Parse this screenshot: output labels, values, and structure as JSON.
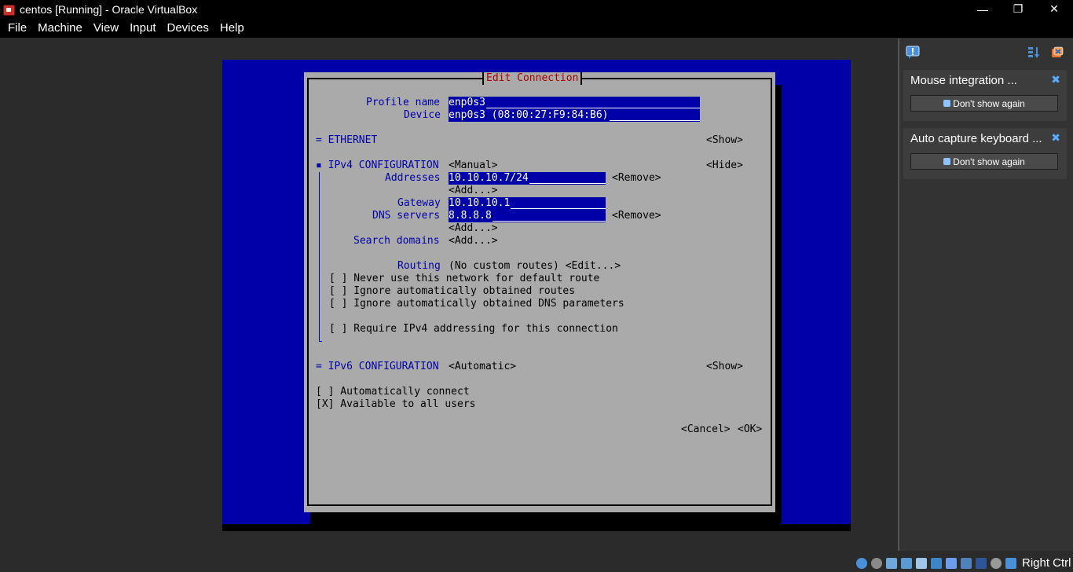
{
  "window": {
    "title": "centos [Running] - Oracle VirtualBox",
    "controls": {
      "minimize": "—",
      "restore": "❐",
      "close": "✕"
    }
  },
  "menu": [
    "File",
    "Machine",
    "View",
    "Input",
    "Devices",
    "Help"
  ],
  "nmtui": {
    "dialog_title": "Edit Connection",
    "profile_name_label": "Profile name",
    "profile_name_value": "enp0s3",
    "device_label": "Device",
    "device_value": "enp0s3 (08:00:27:F9:84:B6)",
    "ethernet_label": "= ETHERNET",
    "ethernet_toggle": "<Show>",
    "ipv4_label": "▪ IPv4 CONFIGURATION",
    "ipv4_mode": "<Manual>",
    "ipv4_toggle": "<Hide>",
    "addresses_label": "Addresses",
    "address_value": "10.10.10.7/24",
    "remove_label": "<Remove>",
    "add_label": "<Add...>",
    "gateway_label": "Gateway",
    "gateway_value": "10.10.10.1",
    "dns_label": "DNS servers",
    "dns_value": "8.8.8.8",
    "search_domains_label": "Search domains",
    "routing_label": "Routing",
    "routing_value": "(No custom routes) <Edit...>",
    "check_never_default": "[ ] Never use this network for default route",
    "check_ignore_routes": "[ ] Ignore automatically obtained routes",
    "check_ignore_dns": "[ ] Ignore automatically obtained DNS parameters",
    "check_require_ipv4": "[ ] Require IPv4 addressing for this connection",
    "ipv6_label": "= IPv6 CONFIGURATION",
    "ipv6_mode": "<Automatic>",
    "ipv6_toggle": "<Show>",
    "auto_connect": "[ ] Automatically connect",
    "all_users": "[X] Available to all users",
    "cancel": "<Cancel>",
    "ok": "<OK>"
  },
  "notifications": [
    {
      "title": "Mouse integration ...",
      "button": "Don't show again"
    },
    {
      "title": "Auto capture keyboard ...",
      "button": "Don't show again"
    }
  ],
  "status": {
    "host_key": "Right Ctrl"
  },
  "colors": {
    "guest_blue": "#0000a8",
    "dialog_gray": "#aaaaaa",
    "title_red": "#a80000",
    "accent_blue": "#5aa9ff"
  }
}
